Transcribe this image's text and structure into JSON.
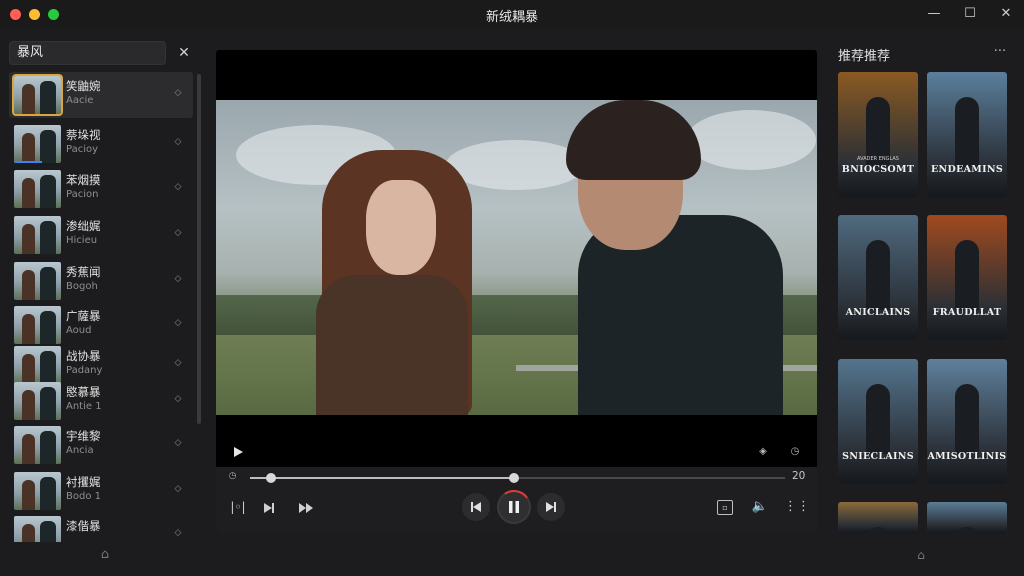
{
  "window": {
    "title": "新绒耦暴"
  },
  "search": {
    "value": "暴风"
  },
  "playlist": [
    {
      "title": "笑鼬婉",
      "sub": "Aacie",
      "progress": 0
    },
    {
      "title": "萘垛视",
      "sub": "Pacioy",
      "progress": 0.6
    },
    {
      "title": "苯烟摸",
      "sub": "Pacion",
      "progress": 0
    },
    {
      "title": "渗绌娓",
      "sub": "Hicieu",
      "progress": 0
    },
    {
      "title": "秀蕉闻",
      "sub": "Bogoh",
      "progress": 0
    },
    {
      "title": "广薩暴",
      "sub": "Aoud",
      "progress": 0
    },
    {
      "title": "战协暴",
      "sub": "Padany",
      "progress": 0
    },
    {
      "title": "愍慕暴",
      "sub": "Antie 1",
      "progress": 0
    },
    {
      "title": "宇维黎",
      "sub": "Ancia",
      "progress": 0
    },
    {
      "title": "衬攫娓",
      "sub": "Bodo 1",
      "progress": 0
    },
    {
      "title": "漆偕暴",
      "sub": "",
      "progress": 0
    }
  ],
  "player": {
    "time_end": "20",
    "progress_fraction": 0.494,
    "loop_fraction": 0.04
  },
  "recommend": {
    "title": "推荐推荐",
    "posters": [
      {
        "title": "BNIOCSOMT",
        "tag": "AVADER ENGLAS",
        "bg": "#8a5a22"
      },
      {
        "title": "ENDEAMINS",
        "tag": "",
        "bg": "#5b7f9c"
      },
      {
        "title": "ANICLAINS",
        "tag": "",
        "bg": "#4f6a7f"
      },
      {
        "title": "FRAUDLLAT",
        "tag": "",
        "bg": "#a04a1e"
      },
      {
        "title": "SNIECLAINS",
        "tag": "",
        "bg": "#54758e"
      },
      {
        "title": "AMISOTLINIS",
        "tag": "",
        "bg": "#5f809b"
      },
      {
        "title": "",
        "tag": "",
        "bg": "#8b6a3a"
      },
      {
        "title": "",
        "tag": "",
        "bg": "#5a7d98"
      }
    ]
  },
  "colors": {
    "accent": "#d9a640",
    "progress_blue": "#3b82f6",
    "ring_red": "#e53935"
  }
}
